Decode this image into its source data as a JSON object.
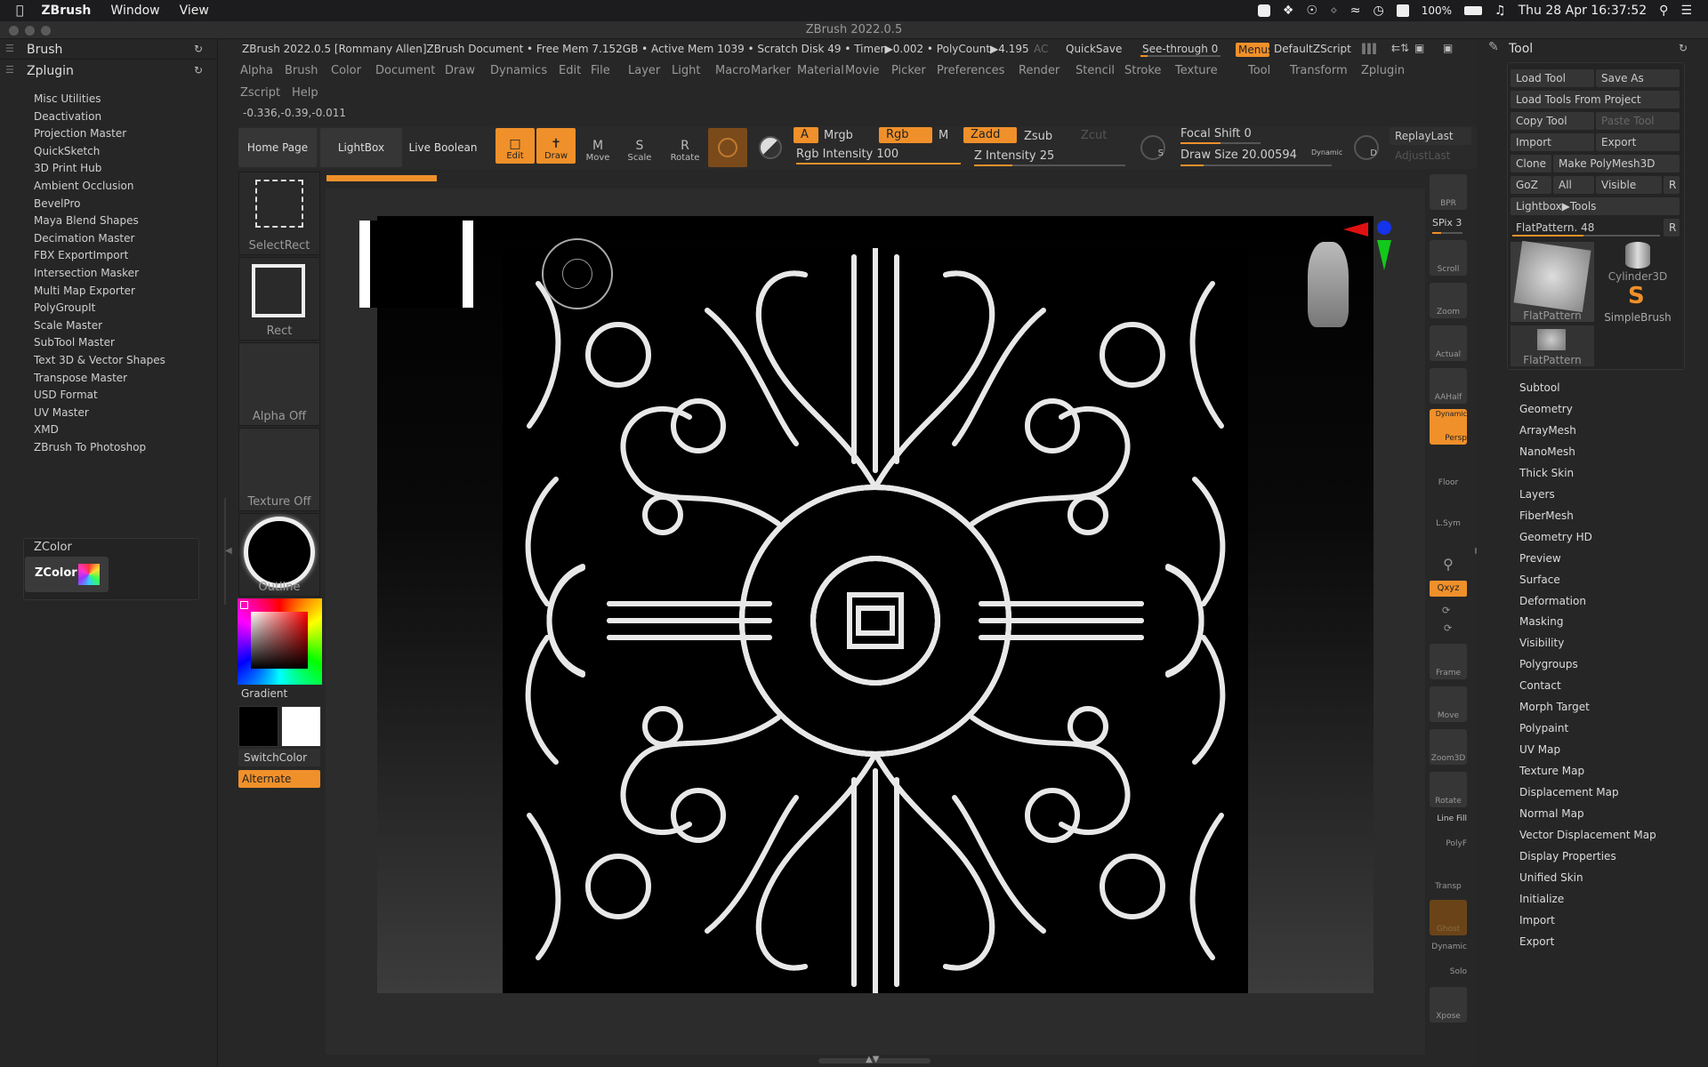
{
  "macos": {
    "app": "ZBrush",
    "menus": [
      "Window",
      "View"
    ],
    "battery": "100%",
    "datetime": "Thu 28 Apr  16:37:52"
  },
  "window": {
    "title": "ZBrush 2022.0.5"
  },
  "left_panel": {
    "brush": "Brush",
    "zplugin": "Zplugin",
    "plugins": [
      "Misc Utilities",
      "Deactivation",
      "Projection Master",
      "QuickSketch",
      "3D Print Hub",
      "Ambient Occlusion",
      "BevelPro",
      "Maya Blend Shapes",
      "Decimation Master",
      "FBX ExportImport",
      "Intersection Masker",
      "Multi Map Exporter",
      "PolyGroupIt",
      "Scale Master",
      "SubTool Master",
      "Text 3D & Vector Shapes",
      "Transpose Master",
      "USD Format",
      "UV Master",
      "XMD",
      "ZBrush To Photoshop"
    ],
    "zcolor_header": "ZColor",
    "zcolor_button": "ZColor"
  },
  "infobar": {
    "doc": "ZBrush 2022.0.5 [Rommany Allen]ZBrush Document",
    "stats": "• Free Mem 7.152GB • Active Mem 1039 • Scratch Disk 49 • Timer▶0.002 • PolyCount▶4.195",
    "ac": "AC",
    "quicksave": "QuickSave",
    "seethrough": "See-through  0",
    "menus": "Menus",
    "script": "DefaultZScript"
  },
  "main_menu": [
    "Alpha",
    "Brush",
    "Color",
    "Document",
    "Draw",
    "Dynamics",
    "Edit",
    "File",
    "Layer",
    "Light",
    "Macro",
    "Marker",
    "Material",
    "Movie",
    "Picker",
    "Preferences",
    "Render",
    "Stencil",
    "Stroke",
    "Texture",
    "Tool",
    "Transform",
    "Zplugin"
  ],
  "main_menu2": [
    "Zscript",
    "Help"
  ],
  "coords": "-0.336,-0.39,-0.011",
  "toolbar": {
    "home": "Home Page",
    "lightbox": "LightBox",
    "liveboolean": "Live Boolean",
    "edit": "Edit",
    "draw": "Draw",
    "move": "Move",
    "scale": "Scale",
    "rotate": "Rotate",
    "a": "A",
    "mrgb": "Mrgb",
    "rgb": "Rgb",
    "m": "M",
    "zadd": "Zadd",
    "zsub": "Zsub",
    "zcut": "Zcut",
    "rgb_intensity": "Rgb Intensity 100",
    "z_intensity": "Z Intensity 25",
    "focal_shift": "Focal Shift 0",
    "draw_size": "Draw Size 20.00594",
    "dynamic": "Dynamic",
    "replay": "ReplayLast",
    "adjust": "AdjustLast",
    "s": "S",
    "d": "D"
  },
  "levels": {
    "rgb_intensity": 1.0,
    "z_intensity": 0.25,
    "draw_size": 0.15,
    "focal_shift": 0.5,
    "flatpattern": 0.48,
    "spix": 0.3
  },
  "side_palette": {
    "selectrect": "SelectRect",
    "rect": "Rect",
    "alpha": "Alpha Off",
    "texture": "Texture Off",
    "outline": "Outline",
    "gradient": "Gradient",
    "switchcolor": "SwitchColor",
    "alternate": "Alternate"
  },
  "right_tools": {
    "bpr": "BPR",
    "spix": "SPix 3",
    "scroll": "Scroll",
    "zoom": "Zoom",
    "actual": "Actual",
    "aahalf": "AAHalf",
    "dynamic": "Dynamic",
    "persp": "Persp",
    "floor": "Floor",
    "lsym": "L.Sym",
    "xyz": "Qxyz",
    "frame": "Frame",
    "move": "Move",
    "zoom3d": "Zoom3D",
    "rotate": "Rotate",
    "linefill": "Line Fill",
    "polyf": "PolyF",
    "transp": "Transp",
    "ghost": "Ghost",
    "dynamic2": "Dynamic",
    "solo": "Solo",
    "xpose": "Xpose"
  },
  "tool_panel": {
    "title": "Tool",
    "load": "Load Tool",
    "saveas": "Save As",
    "loadproj": "Load Tools From Project",
    "copy": "Copy Tool",
    "paste": "Paste Tool",
    "import": "Import",
    "export": "Export",
    "clone": "Clone",
    "makepoly": "Make PolyMesh3D",
    "goz": "GoZ",
    "all": "All",
    "visible": "Visible",
    "r": "R",
    "lightbox_tools": "Lightbox▶Tools",
    "flatpattern": "FlatPattern. 48",
    "thumb1": "FlatPattern",
    "thumb2": "Cylinder3D",
    "thumb3": "SimpleBrush",
    "thumb4": "FlatPattern",
    "items": [
      "Subtool",
      "Geometry",
      "ArrayMesh",
      "NanoMesh",
      "Thick Skin",
      "Layers",
      "FiberMesh",
      "Geometry HD",
      "Preview",
      "Surface",
      "Deformation",
      "Masking",
      "Visibility",
      "Polygroups",
      "Contact",
      "Morph Target",
      "Polypaint",
      "UV Map",
      "Texture Map",
      "Displacement Map",
      "Normal Map",
      "Vector Displacement Map",
      "Display Properties",
      "Unified Skin",
      "Initialize",
      "Import",
      "Export"
    ]
  },
  "colors": {
    "accent": "#f0902a",
    "panel": "#262626",
    "canvas_bg": "#111111"
  }
}
